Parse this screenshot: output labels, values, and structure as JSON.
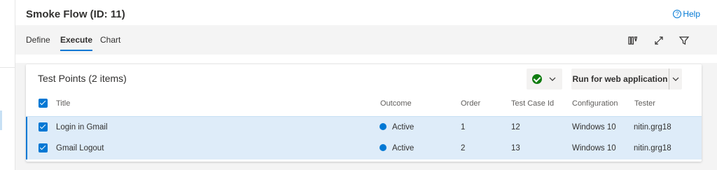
{
  "page": {
    "title": "Smoke Flow (ID: 11)",
    "help_label": "Help"
  },
  "tabs": [
    {
      "label": "Define",
      "active": false
    },
    {
      "label": "Execute",
      "active": true
    },
    {
      "label": "Chart",
      "active": false
    }
  ],
  "toolbar_icons": [
    "column-options-icon",
    "expand-icon",
    "filter-icon"
  ],
  "test_points": {
    "title": "Test Points (2 items)",
    "outcome_filter_icon": "success-check-icon",
    "run_button_label": "Run for web application",
    "columns": [
      "Title",
      "Outcome",
      "Order",
      "Test Case Id",
      "Configuration",
      "Tester"
    ],
    "rows": [
      {
        "title": "Login in Gmail",
        "outcome": "Active",
        "order": "1",
        "test_case_id": "12",
        "configuration": "Windows 10",
        "tester": "nitin.grg18",
        "selected": true
      },
      {
        "title": "Gmail Logout",
        "outcome": "Active",
        "order": "2",
        "test_case_id": "13",
        "configuration": "Windows 10",
        "tester": "nitin.grg18",
        "selected": true
      }
    ]
  },
  "colors": {
    "accent": "#0078d4",
    "success": "#107c10",
    "selected_row": "#deecf9"
  }
}
